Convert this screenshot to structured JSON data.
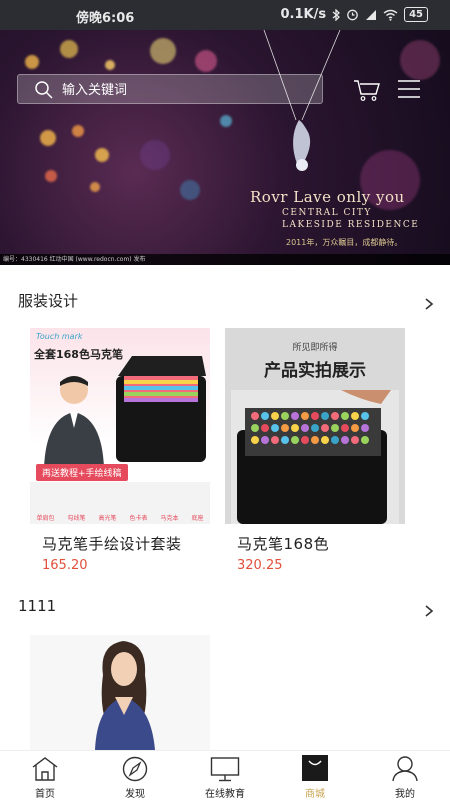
{
  "status_bar": {
    "time": "傍晚6:06",
    "network_speed": "0.1K/s",
    "battery": "45"
  },
  "banner": {
    "search_placeholder": "输入关键词",
    "brand": "Rovr Lave only you",
    "sub_line1": "CENTRAL CITY",
    "sub_line2": "LAKESIDE RESIDENCE",
    "tagline": "2011年，万众瞩目，成都静待。",
    "watermark": "编号：4330416  红动中国 (www.redocn.com)  发布"
  },
  "sections": [
    {
      "title": "服装设计",
      "products": [
        {
          "name": "马克笔手绘设计套装",
          "price": "165.20",
          "image": {
            "header": "全套168色马克笔",
            "logo": "Touch mark",
            "promo": "再送教程+手绘线稿",
            "icons": [
              "单肩包",
              "勾线笔",
              "高光笔",
              "色卡表",
              "马克本",
              "底座"
            ]
          }
        },
        {
          "name": "马克笔168色",
          "price": "320.25",
          "image": {
            "kicker": "所见即所得",
            "header": "产品实拍展示"
          }
        }
      ]
    },
    {
      "title": "1111",
      "products": [
        {
          "name": "",
          "price": ""
        }
      ]
    }
  ],
  "tab_bar": {
    "active_color": "#c9a552",
    "tabs": [
      {
        "label": "首页",
        "icon": "home-icon"
      },
      {
        "label": "发现",
        "icon": "compass-icon"
      },
      {
        "label": "在线教育",
        "icon": "monitor-icon"
      },
      {
        "label": "商城",
        "icon": "shopping-bag-icon"
      },
      {
        "label": "我的",
        "icon": "user-icon"
      }
    ]
  }
}
